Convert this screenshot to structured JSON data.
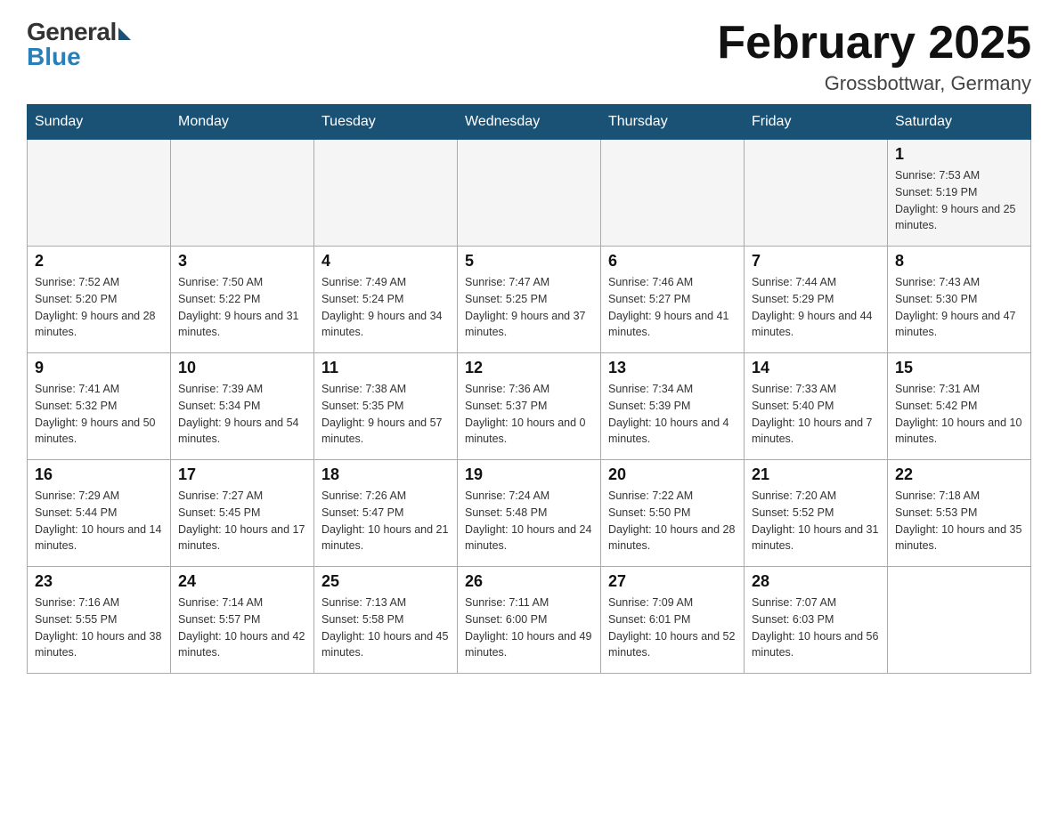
{
  "header": {
    "logo_general": "General",
    "logo_blue": "Blue",
    "title": "February 2025",
    "location": "Grossbottwar, Germany"
  },
  "weekdays": [
    "Sunday",
    "Monday",
    "Tuesday",
    "Wednesday",
    "Thursday",
    "Friday",
    "Saturday"
  ],
  "weeks": [
    [
      {
        "day": "",
        "info": ""
      },
      {
        "day": "",
        "info": ""
      },
      {
        "day": "",
        "info": ""
      },
      {
        "day": "",
        "info": ""
      },
      {
        "day": "",
        "info": ""
      },
      {
        "day": "",
        "info": ""
      },
      {
        "day": "1",
        "info": "Sunrise: 7:53 AM\nSunset: 5:19 PM\nDaylight: 9 hours and 25 minutes."
      }
    ],
    [
      {
        "day": "2",
        "info": "Sunrise: 7:52 AM\nSunset: 5:20 PM\nDaylight: 9 hours and 28 minutes."
      },
      {
        "day": "3",
        "info": "Sunrise: 7:50 AM\nSunset: 5:22 PM\nDaylight: 9 hours and 31 minutes."
      },
      {
        "day": "4",
        "info": "Sunrise: 7:49 AM\nSunset: 5:24 PM\nDaylight: 9 hours and 34 minutes."
      },
      {
        "day": "5",
        "info": "Sunrise: 7:47 AM\nSunset: 5:25 PM\nDaylight: 9 hours and 37 minutes."
      },
      {
        "day": "6",
        "info": "Sunrise: 7:46 AM\nSunset: 5:27 PM\nDaylight: 9 hours and 41 minutes."
      },
      {
        "day": "7",
        "info": "Sunrise: 7:44 AM\nSunset: 5:29 PM\nDaylight: 9 hours and 44 minutes."
      },
      {
        "day": "8",
        "info": "Sunrise: 7:43 AM\nSunset: 5:30 PM\nDaylight: 9 hours and 47 minutes."
      }
    ],
    [
      {
        "day": "9",
        "info": "Sunrise: 7:41 AM\nSunset: 5:32 PM\nDaylight: 9 hours and 50 minutes."
      },
      {
        "day": "10",
        "info": "Sunrise: 7:39 AM\nSunset: 5:34 PM\nDaylight: 9 hours and 54 minutes."
      },
      {
        "day": "11",
        "info": "Sunrise: 7:38 AM\nSunset: 5:35 PM\nDaylight: 9 hours and 57 minutes."
      },
      {
        "day": "12",
        "info": "Sunrise: 7:36 AM\nSunset: 5:37 PM\nDaylight: 10 hours and 0 minutes."
      },
      {
        "day": "13",
        "info": "Sunrise: 7:34 AM\nSunset: 5:39 PM\nDaylight: 10 hours and 4 minutes."
      },
      {
        "day": "14",
        "info": "Sunrise: 7:33 AM\nSunset: 5:40 PM\nDaylight: 10 hours and 7 minutes."
      },
      {
        "day": "15",
        "info": "Sunrise: 7:31 AM\nSunset: 5:42 PM\nDaylight: 10 hours and 10 minutes."
      }
    ],
    [
      {
        "day": "16",
        "info": "Sunrise: 7:29 AM\nSunset: 5:44 PM\nDaylight: 10 hours and 14 minutes."
      },
      {
        "day": "17",
        "info": "Sunrise: 7:27 AM\nSunset: 5:45 PM\nDaylight: 10 hours and 17 minutes."
      },
      {
        "day": "18",
        "info": "Sunrise: 7:26 AM\nSunset: 5:47 PM\nDaylight: 10 hours and 21 minutes."
      },
      {
        "day": "19",
        "info": "Sunrise: 7:24 AM\nSunset: 5:48 PM\nDaylight: 10 hours and 24 minutes."
      },
      {
        "day": "20",
        "info": "Sunrise: 7:22 AM\nSunset: 5:50 PM\nDaylight: 10 hours and 28 minutes."
      },
      {
        "day": "21",
        "info": "Sunrise: 7:20 AM\nSunset: 5:52 PM\nDaylight: 10 hours and 31 minutes."
      },
      {
        "day": "22",
        "info": "Sunrise: 7:18 AM\nSunset: 5:53 PM\nDaylight: 10 hours and 35 minutes."
      }
    ],
    [
      {
        "day": "23",
        "info": "Sunrise: 7:16 AM\nSunset: 5:55 PM\nDaylight: 10 hours and 38 minutes."
      },
      {
        "day": "24",
        "info": "Sunrise: 7:14 AM\nSunset: 5:57 PM\nDaylight: 10 hours and 42 minutes."
      },
      {
        "day": "25",
        "info": "Sunrise: 7:13 AM\nSunset: 5:58 PM\nDaylight: 10 hours and 45 minutes."
      },
      {
        "day": "26",
        "info": "Sunrise: 7:11 AM\nSunset: 6:00 PM\nDaylight: 10 hours and 49 minutes."
      },
      {
        "day": "27",
        "info": "Sunrise: 7:09 AM\nSunset: 6:01 PM\nDaylight: 10 hours and 52 minutes."
      },
      {
        "day": "28",
        "info": "Sunrise: 7:07 AM\nSunset: 6:03 PM\nDaylight: 10 hours and 56 minutes."
      },
      {
        "day": "",
        "info": ""
      }
    ]
  ]
}
